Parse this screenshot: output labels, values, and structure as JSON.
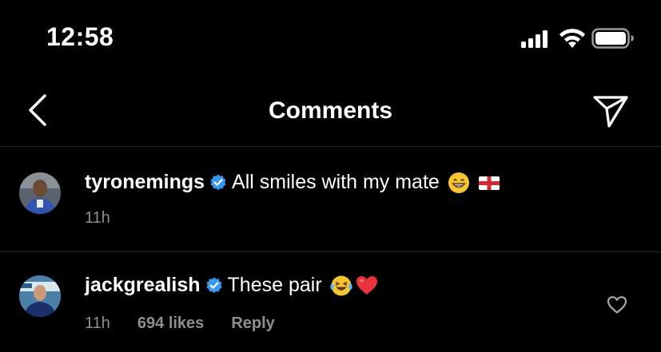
{
  "status_bar": {
    "time": "12:58"
  },
  "header": {
    "title": "Comments"
  },
  "comments": [
    {
      "username": "tyronemings",
      "verified": true,
      "text": "All smiles with my mate",
      "emojis": [
        "grinning-face",
        "england-flag"
      ],
      "time": "11h"
    },
    {
      "username": "jackgrealish",
      "verified": true,
      "text": "These pair",
      "emojis": [
        "laughing-tears-face",
        "red-heart"
      ],
      "time": "11h",
      "likes": "694 likes",
      "reply_label": "Reply"
    }
  ],
  "colors": {
    "background": "#000000",
    "text": "#ffffff",
    "secondary_text": "#8e8e8e",
    "verified": "#3897f0",
    "divider": "#262626"
  }
}
